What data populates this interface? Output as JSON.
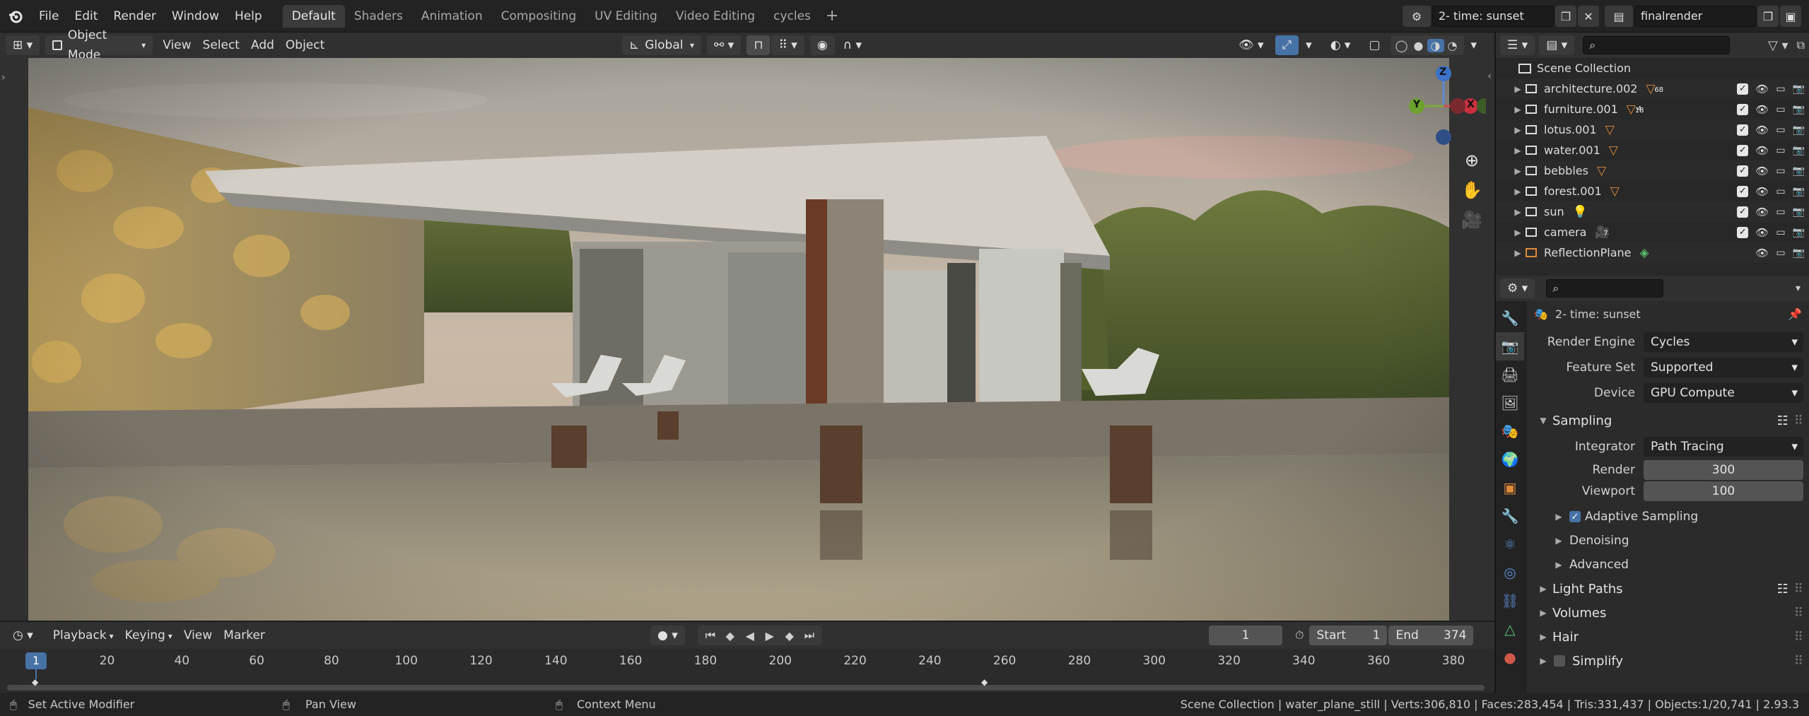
{
  "menu": [
    "File",
    "Edit",
    "Render",
    "Window",
    "Help"
  ],
  "workspaces": [
    {
      "label": "Default",
      "active": true
    },
    {
      "label": "Shaders",
      "active": false
    },
    {
      "label": "Animation",
      "active": false
    },
    {
      "label": "Compositing",
      "active": false
    },
    {
      "label": "UV Editing",
      "active": false
    },
    {
      "label": "Video Editing",
      "active": false
    },
    {
      "label": "cycles",
      "active": false
    }
  ],
  "scene_name": "2- time: sunset",
  "view_layer": "finalrender",
  "viewport_header": {
    "mode": "Object Mode",
    "menus": [
      "View",
      "Select",
      "Add",
      "Object"
    ],
    "orientation": "Global"
  },
  "gizmo_axes": {
    "z": "Z",
    "y": "Y",
    "x": "X"
  },
  "outliner": {
    "root": "Scene Collection",
    "items": [
      {
        "name": "architecture.002",
        "icon": "mesh-icon",
        "badge": "68"
      },
      {
        "name": "furniture.001",
        "icon": "mesh-icon",
        "badge": "18",
        "extra": "4"
      },
      {
        "name": "lotus.001",
        "icon": "mesh-icon",
        "badge": ""
      },
      {
        "name": "water.001",
        "icon": "mesh-icon",
        "badge": ""
      },
      {
        "name": "bebbles",
        "icon": "mesh-icon",
        "badge": ""
      },
      {
        "name": "forest.001",
        "icon": "mesh-icon",
        "badge": ""
      },
      {
        "name": "sun",
        "icon": "light-icon",
        "badge": ""
      },
      {
        "name": "camera",
        "icon": "camera-icon",
        "badge": "7"
      },
      {
        "name": "ReflectionPlane",
        "icon": "probe-icon",
        "badge": ""
      }
    ]
  },
  "properties": {
    "context": "2- time: sunset",
    "render_engine_label": "Render Engine",
    "render_engine": "Cycles",
    "feature_set_label": "Feature Set",
    "feature_set": "Supported",
    "device_label": "Device",
    "device": "GPU Compute",
    "sampling": {
      "title": "Sampling",
      "integrator_label": "Integrator",
      "integrator": "Path Tracing",
      "render_label": "Render",
      "render": "300",
      "viewport_label": "Viewport",
      "viewport": "100",
      "adaptive": "Adaptive Sampling",
      "denoising": "Denoising",
      "advanced": "Advanced"
    },
    "panels": [
      "Light Paths",
      "Volumes",
      "Hair",
      "Simplify"
    ]
  },
  "timeline": {
    "menus": [
      "Playback",
      "Keying",
      "View",
      "Marker"
    ],
    "current_frame": "1",
    "start_label": "Start",
    "start": "1",
    "end_label": "End",
    "end": "374",
    "ticks": [
      "20",
      "40",
      "60",
      "80",
      "100",
      "120",
      "140",
      "160",
      "180",
      "200",
      "220",
      "240",
      "260",
      "280",
      "300",
      "320",
      "340",
      "360",
      "380"
    ],
    "marker_frame": "1"
  },
  "status": {
    "left1": "Set Active Modifier",
    "left2": "Pan View",
    "left3": "Context Menu",
    "right": "Scene Collection | water_plane_still | Verts:306,810 | Faces:283,454 | Tris:331,437 | Objects:1/20,741 | 2.93.3"
  }
}
